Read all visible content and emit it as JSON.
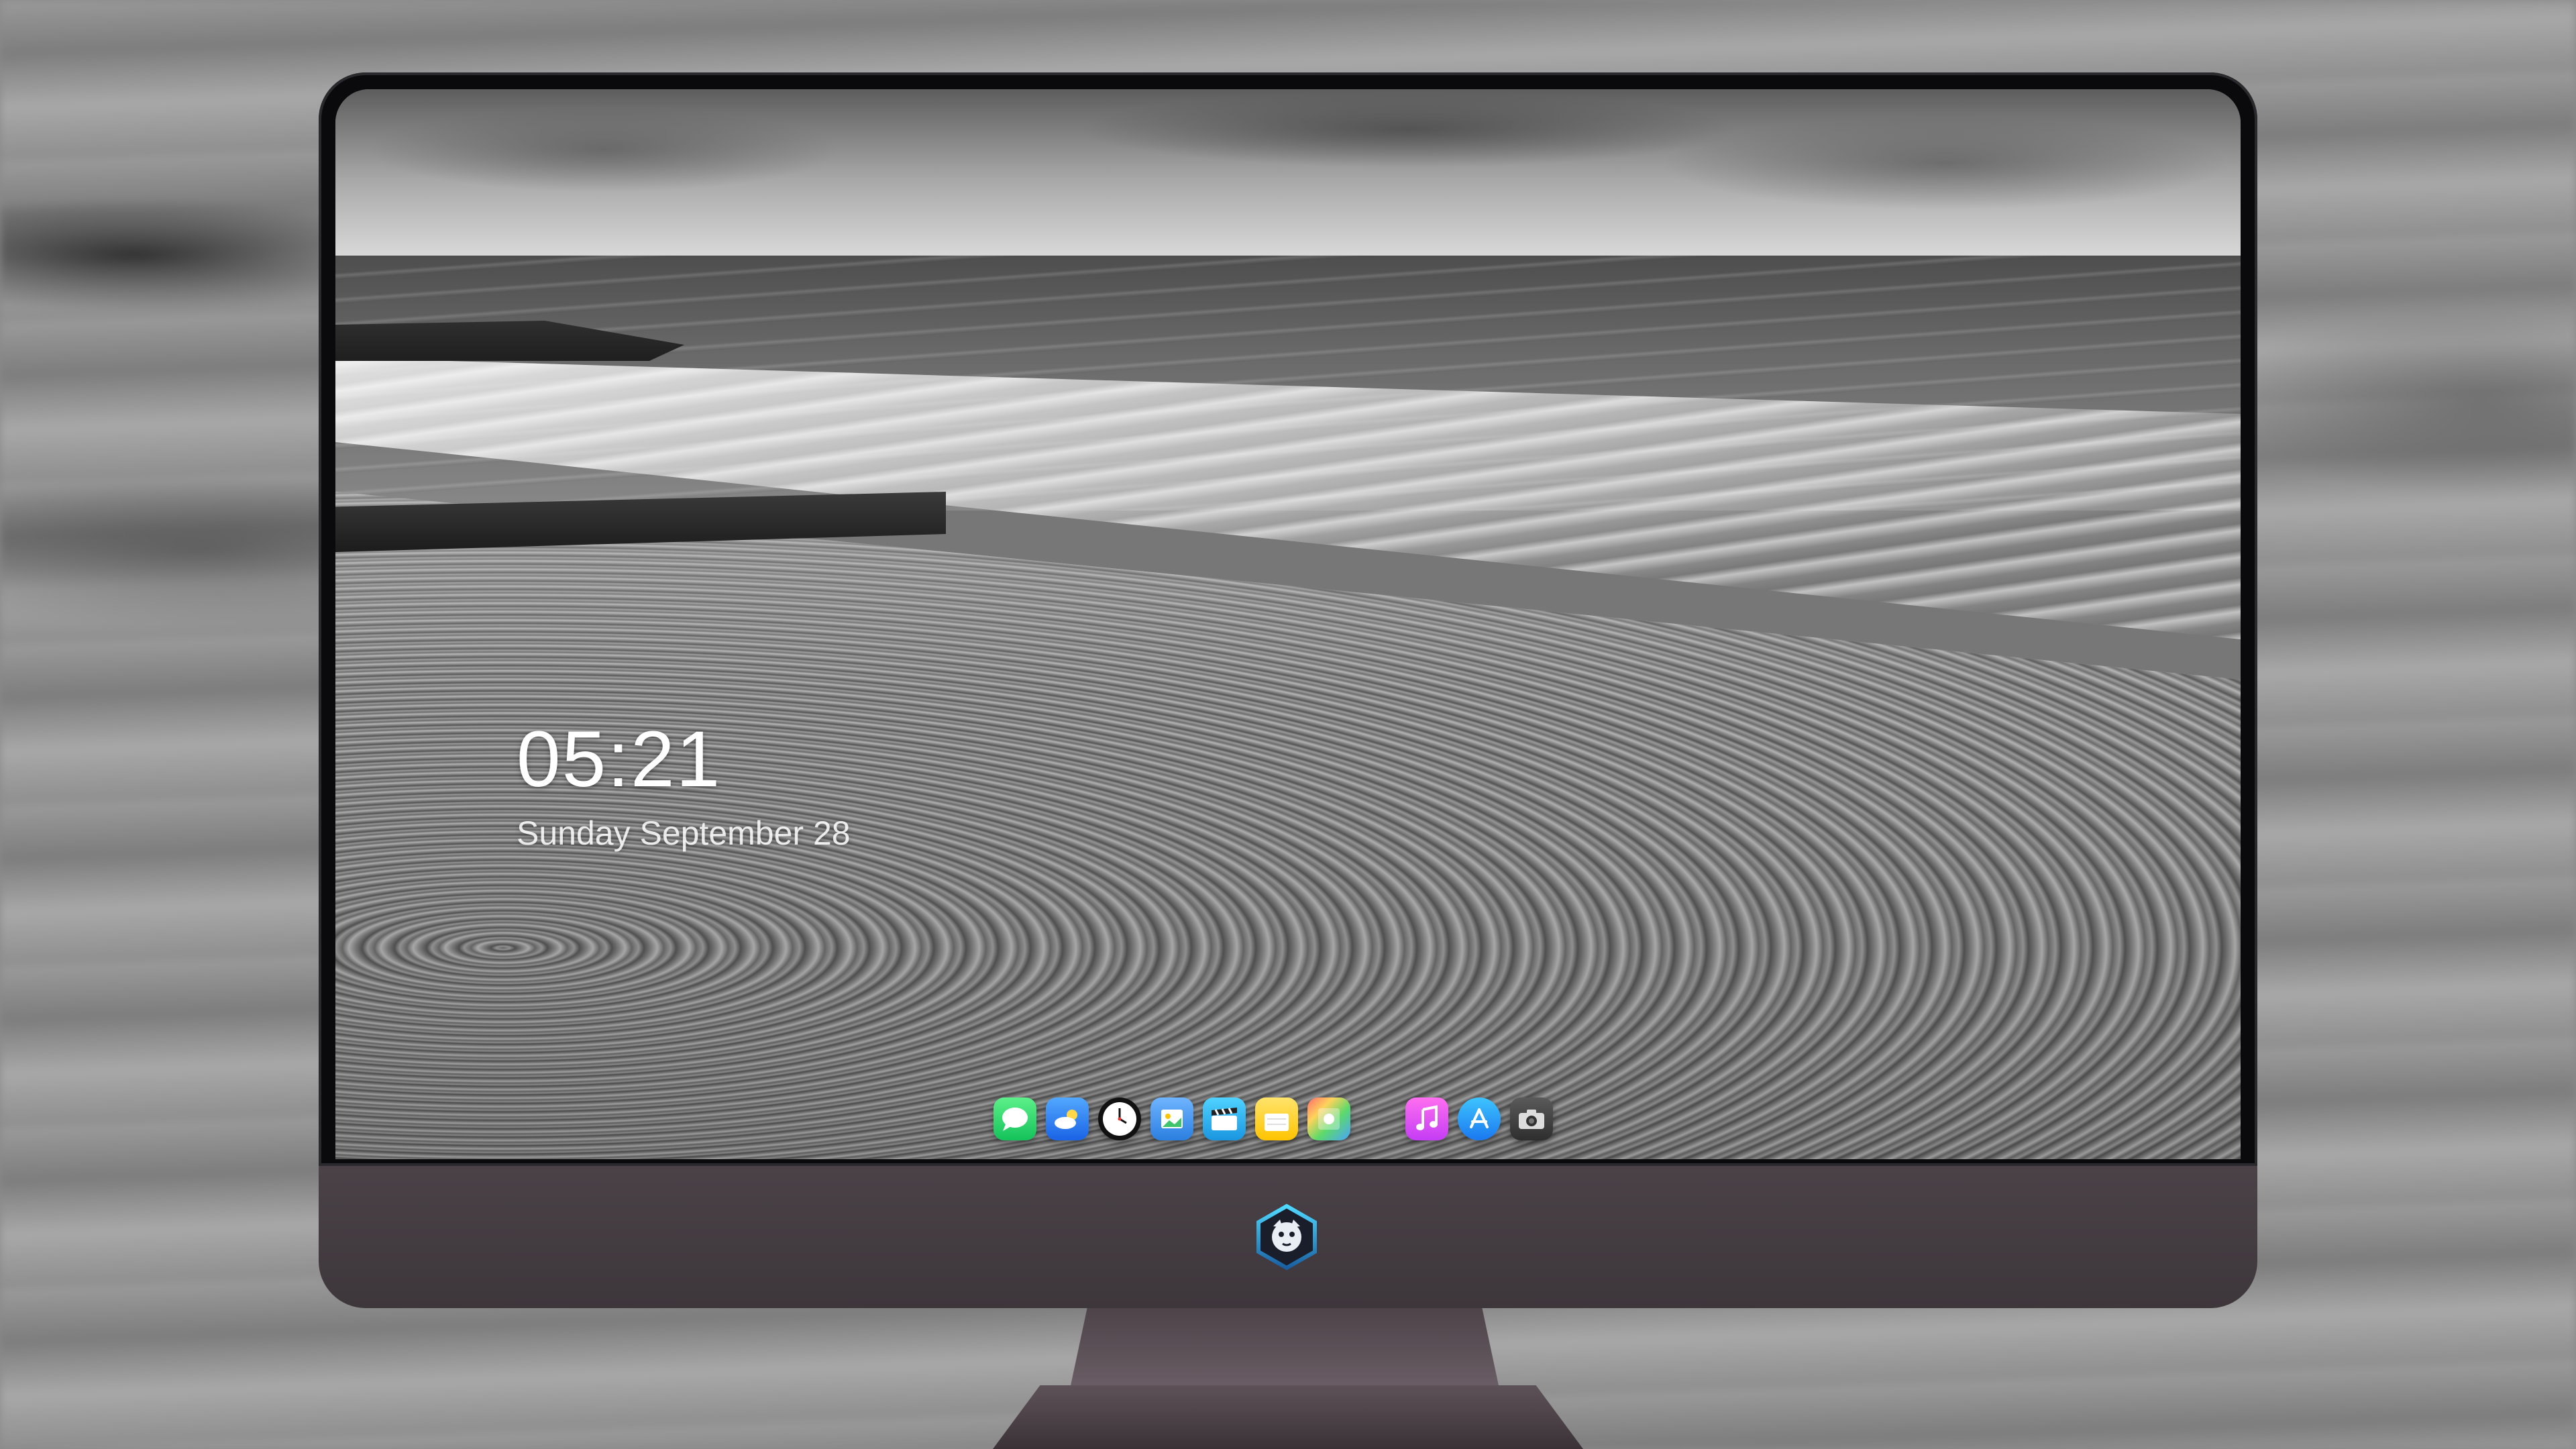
{
  "lock_widget": {
    "time": "05:21",
    "date": "Sunday September 28"
  },
  "dock": {
    "apps": [
      {
        "name": "Messages",
        "icon": "messages-icon"
      },
      {
        "name": "Weather",
        "icon": "weather-icon"
      },
      {
        "name": "Clock",
        "icon": "clock-icon"
      },
      {
        "name": "Preview",
        "icon": "preview-icon"
      },
      {
        "name": "Claquette",
        "icon": "clapperboard-icon"
      },
      {
        "name": "Notes",
        "icon": "notes-icon"
      },
      {
        "name": "Photo Booth",
        "icon": "photos-icon"
      },
      {
        "name": "Music",
        "icon": "music-note-icon"
      },
      {
        "name": "App Store",
        "icon": "app-store-icon"
      },
      {
        "name": "Camera",
        "icon": "camera-icon"
      }
    ]
  },
  "colors": {
    "bezel": "#0a0a0c",
    "chin": "#443c41",
    "clock_text": "#ffffff"
  }
}
